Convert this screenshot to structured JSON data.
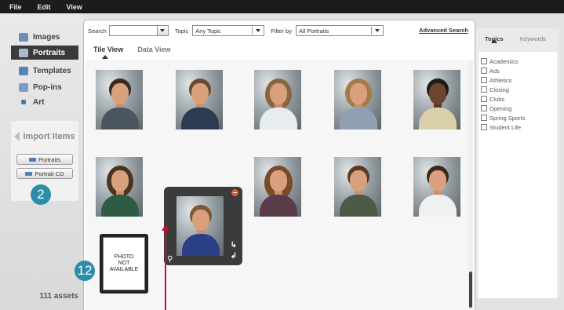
{
  "menu": [
    "File",
    "Edit",
    "View"
  ],
  "sidebar": {
    "items": [
      {
        "label": "Images",
        "icon": "images-icon",
        "active": false
      },
      {
        "label": "Portraits",
        "icon": "portraits-icon",
        "active": true
      },
      {
        "label": "Templates",
        "icon": "templates-icon",
        "active": false
      },
      {
        "label": "Pop-ins",
        "icon": "pop-ins-icon",
        "active": false
      },
      {
        "label": "Art",
        "icon": "art-icon",
        "active": false
      }
    ],
    "import_title": "Import Items",
    "import_buttons": [
      "Portraits",
      "Portrait CD"
    ],
    "assets_count": "111 assets"
  },
  "callouts": {
    "import": "2",
    "not_available": "12"
  },
  "filterbar": {
    "search_label": "Search",
    "search_value": "",
    "topic_label": "Topic",
    "topic_value": "Any Topic",
    "filter_label": "Filter by",
    "filter_value": "All Portraits",
    "advanced_search": "Advanced Search"
  },
  "view_tabs": {
    "tile": "Tile View",
    "data": "Data View",
    "selected": "Tile View"
  },
  "tiles": {
    "selected_index": 6,
    "not_available_text": [
      "PHOTO",
      "NOT",
      "AVAILABLE"
    ]
  },
  "right_panel": {
    "tabs": [
      "Topics",
      "Keywords"
    ],
    "selected_tab": "Topics",
    "topics": [
      "Academics",
      "Ads",
      "Athletics",
      "Closing",
      "Clubs",
      "Opening",
      "Spring Sports",
      "Student Life"
    ]
  },
  "colors": {
    "menubar": "#1c1c1c",
    "active_nav": "#3a3a3a",
    "callout": "#2c8da9",
    "annotation_arrow": "#c8102e",
    "remove_badge": "#e25a36"
  }
}
